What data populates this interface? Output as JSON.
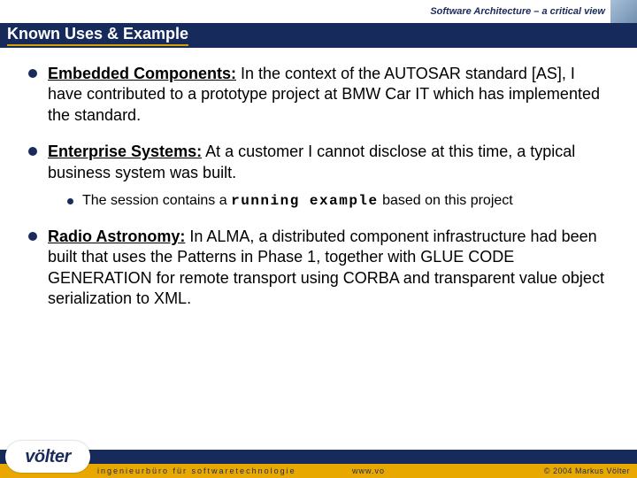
{
  "header": {
    "caption": "Software Architecture – a critical view"
  },
  "title": "Known Uses & Example",
  "bullets": [
    {
      "label": "Embedded Components:",
      "text": " In the context of the AUTOSAR standard [AS], I have contributed to a prototype project at BMW Car IT which has implemented the standard."
    },
    {
      "label": "Enterprise Systems:",
      "text": " At a customer I cannot disclose at this time, a typical business system was built.",
      "sub": {
        "pre": "The session contains a ",
        "emph": "running example",
        "post": " based on this project"
      }
    },
    {
      "label": "Radio Astronomy:",
      "text": " In ALMA, a distributed component infrastructure had been built that uses the Patterns in Phase 1, together with GLUE CODE GENERATION for remote transport using CORBA and transparent value object serialization to XML."
    }
  ],
  "footer": {
    "tagline": "ingenieurbüro für softwaretechnologie",
    "link": "www.vo",
    "copyright": "© 2004 Markus Völter",
    "logo": "völter"
  }
}
